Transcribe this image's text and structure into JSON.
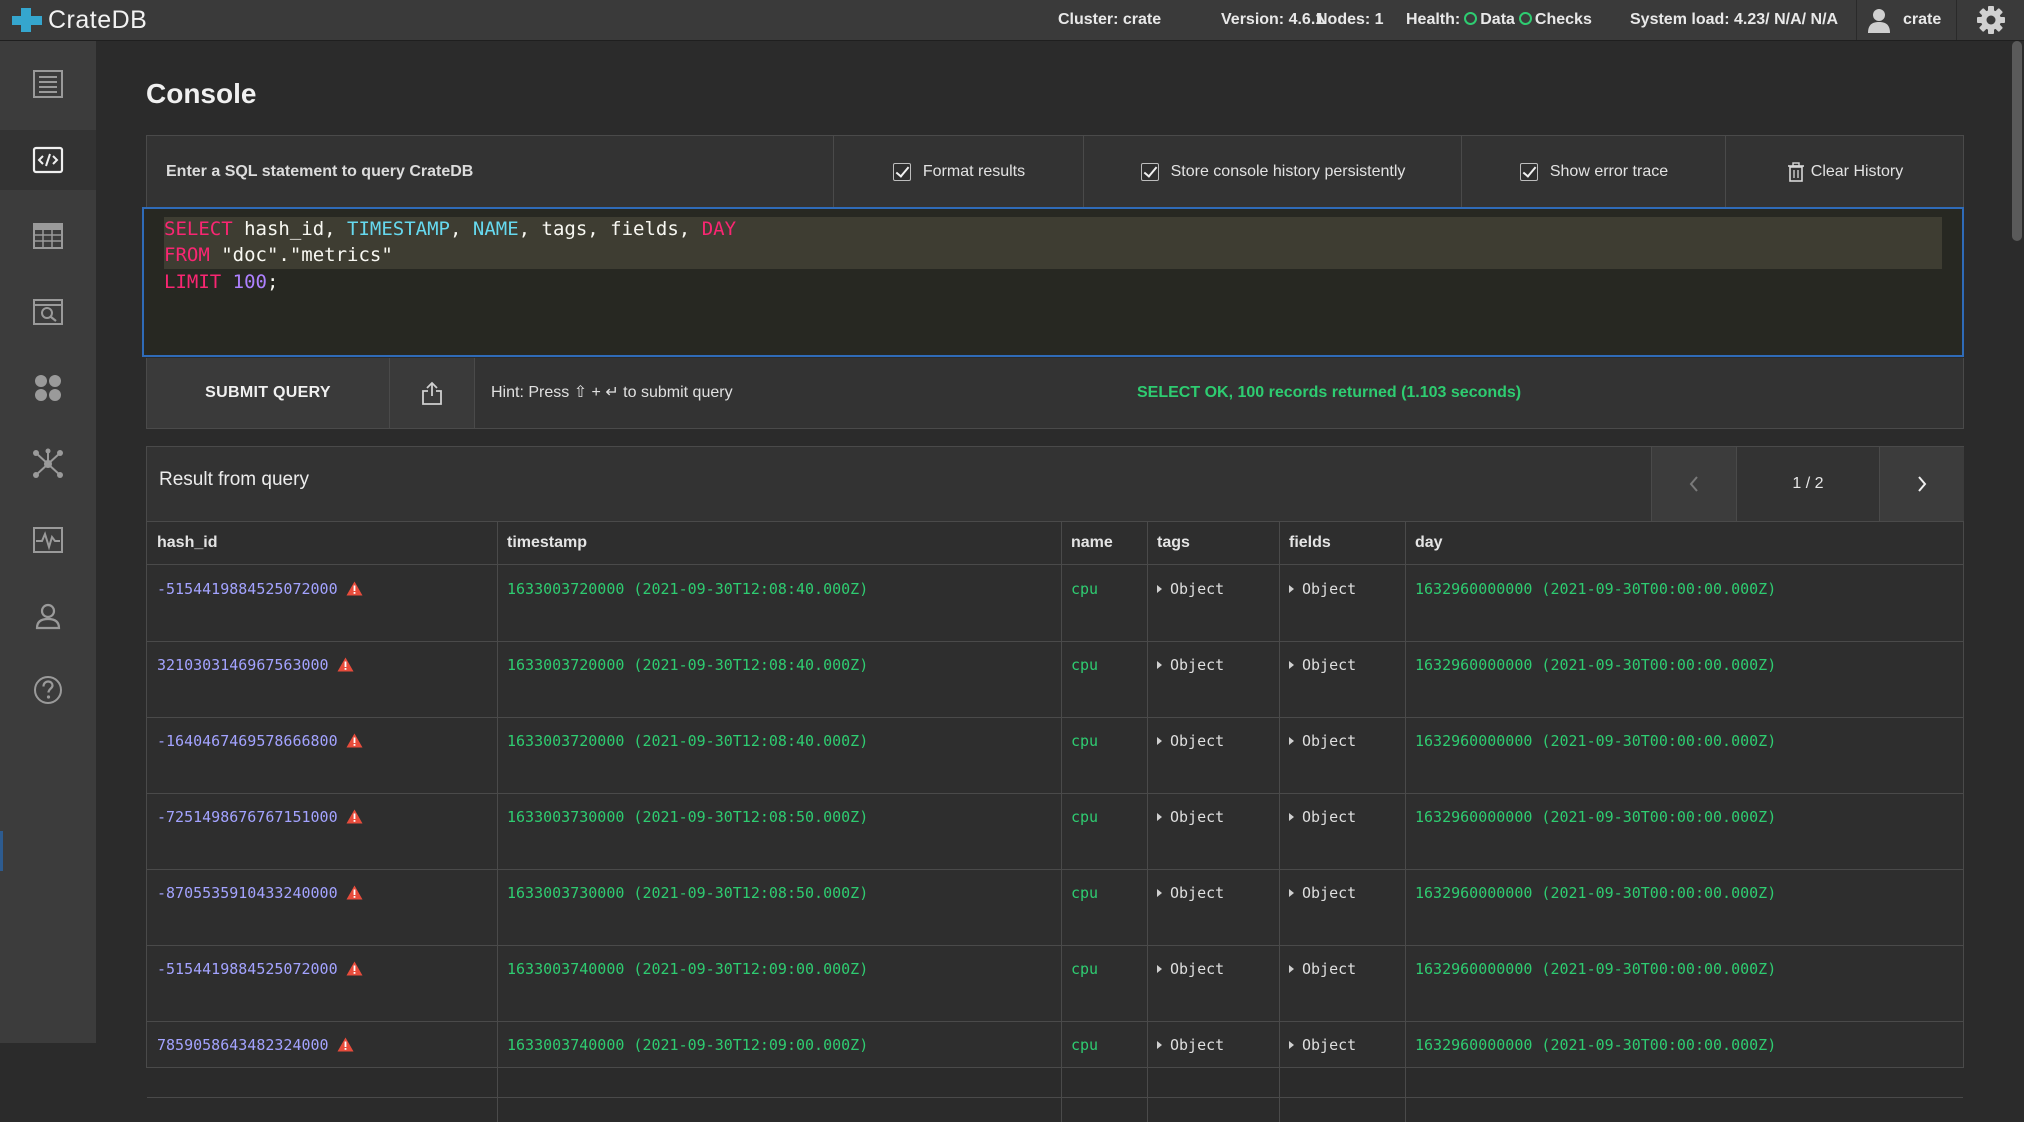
{
  "app": {
    "logo_text": "CrateDB"
  },
  "header": {
    "cluster": "Cluster: crate",
    "version": "Version: 4.6.1",
    "nodes": "Nodes: 1",
    "health_label": "Health:",
    "health_data": "Data",
    "health_checks": "Checks",
    "system_load": "System load: 4.23/ N/A/ N/A",
    "username": "crate"
  },
  "colors": {
    "accent": "#35a6ce",
    "ok": "#2ecc71",
    "warning": "#e74c3c",
    "editor_border": "#2f6bb8"
  },
  "sidebar": {
    "items": [
      {
        "icon": "overview-icon"
      },
      {
        "icon": "console-icon",
        "active": true
      },
      {
        "icon": "tables-icon"
      },
      {
        "icon": "views-icon"
      },
      {
        "icon": "shards-icon"
      },
      {
        "icon": "cluster-icon"
      },
      {
        "icon": "monitoring-icon"
      },
      {
        "icon": "users-icon"
      },
      {
        "icon": "help-icon"
      }
    ]
  },
  "page": {
    "title": "Console"
  },
  "console": {
    "label": "Enter a SQL statement to query CrateDB",
    "format_results": "Format results",
    "store_history": "Store console history persistently",
    "show_error_trace": "Show error trace",
    "clear_history": "Clear History",
    "query_lines": [
      "SELECT hash_id, TIMESTAMP, NAME, tags, fields, DAY",
      "FROM \"doc\".\"metrics\"",
      "LIMIT 100;"
    ],
    "submit_label": "SUBMIT QUERY",
    "hint": "Hint: Press ⇧ + ↵ to submit query",
    "status": "SELECT OK, 100 records returned (1.103 seconds)"
  },
  "results": {
    "title": "Result from query",
    "page_info": "1 / 2",
    "columns": [
      "hash_id",
      "timestamp",
      "name",
      "tags",
      "fields",
      "day"
    ],
    "rows": [
      {
        "hash_id": "-5154419884525072000",
        "timestamp": "1633003720000 (2021-09-30T12:08:40.000Z)",
        "name": "cpu",
        "tags": "Object",
        "fields": "Object",
        "day": "1632960000000 (2021-09-30T00:00:00.000Z)"
      },
      {
        "hash_id": "3210303146967563000",
        "timestamp": "1633003720000 (2021-09-30T12:08:40.000Z)",
        "name": "cpu",
        "tags": "Object",
        "fields": "Object",
        "day": "1632960000000 (2021-09-30T00:00:00.000Z)"
      },
      {
        "hash_id": "-1640467469578666800",
        "timestamp": "1633003720000 (2021-09-30T12:08:40.000Z)",
        "name": "cpu",
        "tags": "Object",
        "fields": "Object",
        "day": "1632960000000 (2021-09-30T00:00:00.000Z)"
      },
      {
        "hash_id": "-7251498676767151000",
        "timestamp": "1633003730000 (2021-09-30T12:08:50.000Z)",
        "name": "cpu",
        "tags": "Object",
        "fields": "Object",
        "day": "1632960000000 (2021-09-30T00:00:00.000Z)"
      },
      {
        "hash_id": "-8705535910433240000",
        "timestamp": "1633003730000 (2021-09-30T12:08:50.000Z)",
        "name": "cpu",
        "tags": "Object",
        "fields": "Object",
        "day": "1632960000000 (2021-09-30T00:00:00.000Z)"
      },
      {
        "hash_id": "-5154419884525072000",
        "timestamp": "1633003740000 (2021-09-30T12:09:00.000Z)",
        "name": "cpu",
        "tags": "Object",
        "fields": "Object",
        "day": "1632960000000 (2021-09-30T00:00:00.000Z)"
      },
      {
        "hash_id": "7859058643482324000",
        "timestamp": "1633003740000 (2021-09-30T12:09:00.000Z)",
        "name": "cpu",
        "tags": "Object",
        "fields": "Object",
        "day": "1632960000000 (2021-09-30T00:00:00.000Z)"
      }
    ]
  }
}
